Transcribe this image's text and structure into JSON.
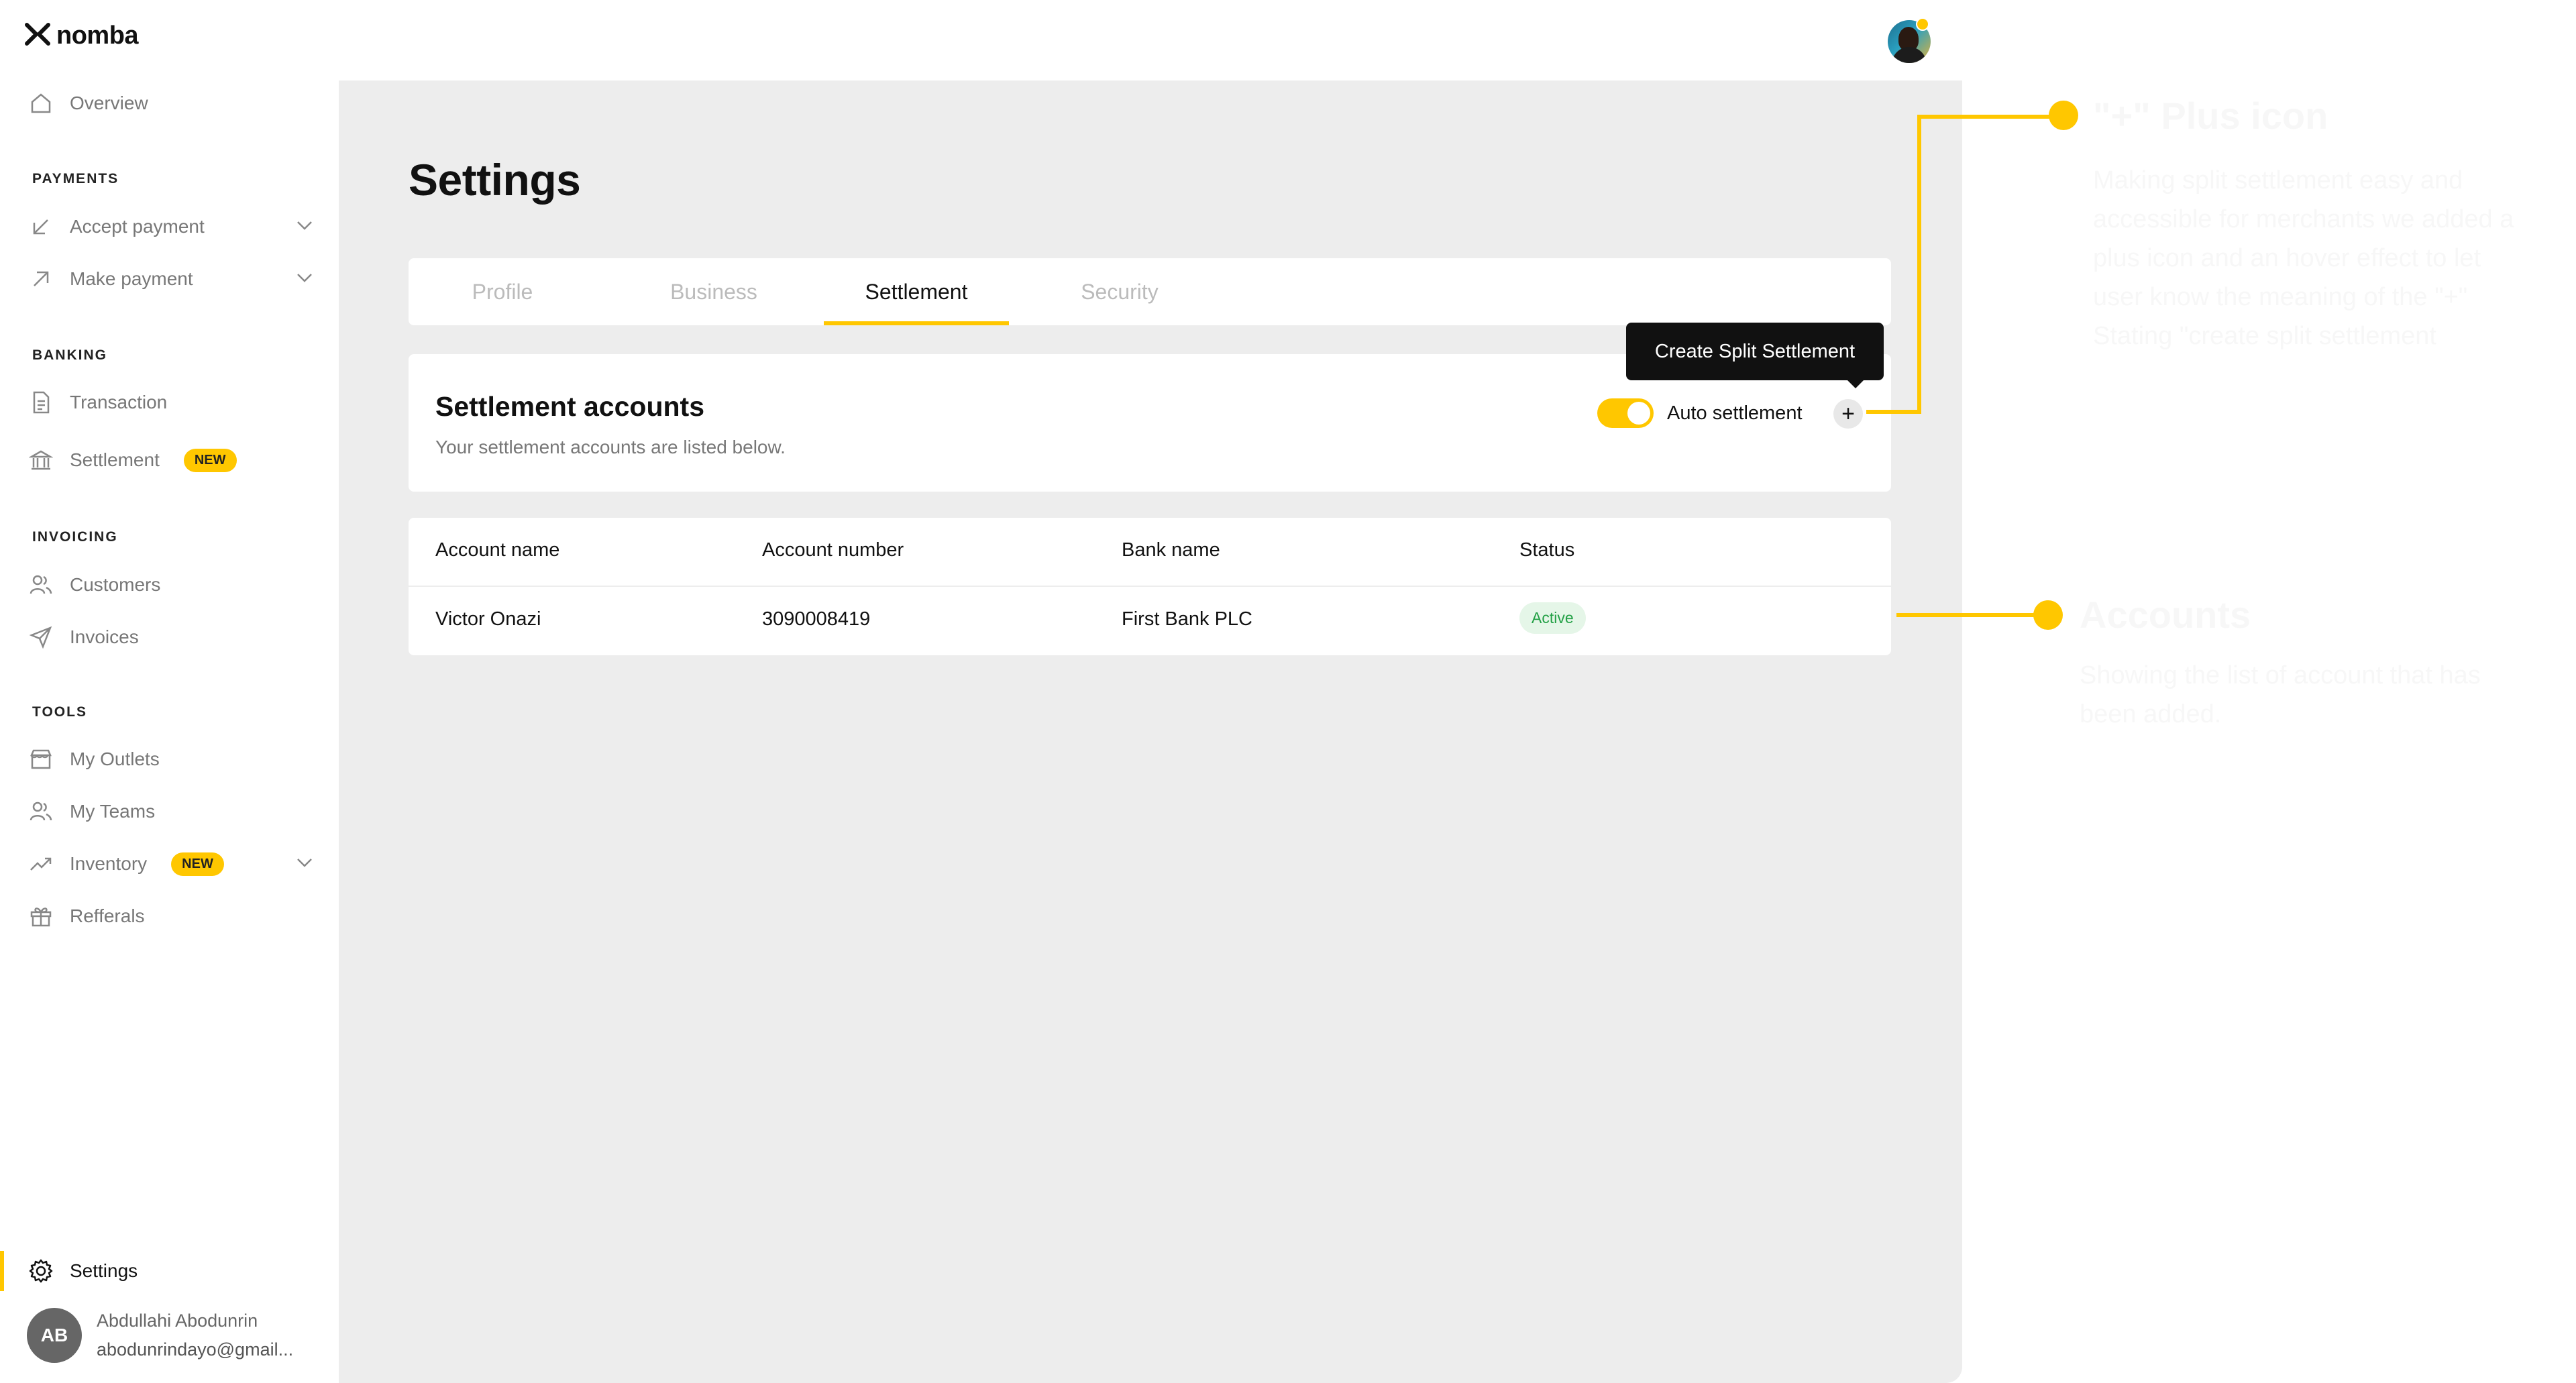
{
  "brand": {
    "logo_text": "nomba",
    "accent": "#FFC700"
  },
  "sidebar": {
    "overview": "Overview",
    "payments_label": "PAYMENTS",
    "accept_payment": "Accept payment",
    "make_payment": "Make payment",
    "banking_label": "BANKING",
    "transaction": "Transaction",
    "settlement": "Settlement",
    "settlement_badge": "NEW",
    "invoicing_label": "INVOICING",
    "customers": "Customers",
    "invoices": "Invoices",
    "tools_label": "TOOLS",
    "my_outlets": "My Outlets",
    "my_teams": "My Teams",
    "inventory": "Inventory",
    "inventory_badge": "NEW",
    "refferals": "Refferals",
    "settings": "Settings"
  },
  "user": {
    "initials": "AB",
    "name": "Abdullahi Abodunrin",
    "email": "abodunrindayo@gmail..."
  },
  "page": {
    "title": "Settings",
    "tabs": [
      "Profile",
      "Business",
      "Settlement",
      "Security"
    ],
    "active_tab": "Settlement"
  },
  "settlement_card": {
    "title": "Settlement accounts",
    "subtitle": "Your settlement accounts are listed below.",
    "toggle_label": "Auto settlement",
    "toggle_on": true,
    "plus_label": "+",
    "tooltip": "Create Split Settlement"
  },
  "accounts_table": {
    "headers": [
      "Account name",
      "Account number",
      "Bank name",
      "Status"
    ],
    "rows": [
      {
        "name": "Victor Onazi",
        "number": "3090008419",
        "bank": "First Bank PLC",
        "status": "Active"
      }
    ]
  },
  "annotations": {
    "plus_title": "\"+\" Plus icon",
    "plus_body": [
      "Making split settlement easy and",
      "accessible for merchants we added a",
      "plus icon and an hover effect to let",
      "user know the meaning of the \"+\"",
      "Stating \"create split settlement"
    ],
    "accounts_title": "Accounts",
    "accounts_body": [
      "Showing the list of account that has",
      "been added."
    ]
  }
}
